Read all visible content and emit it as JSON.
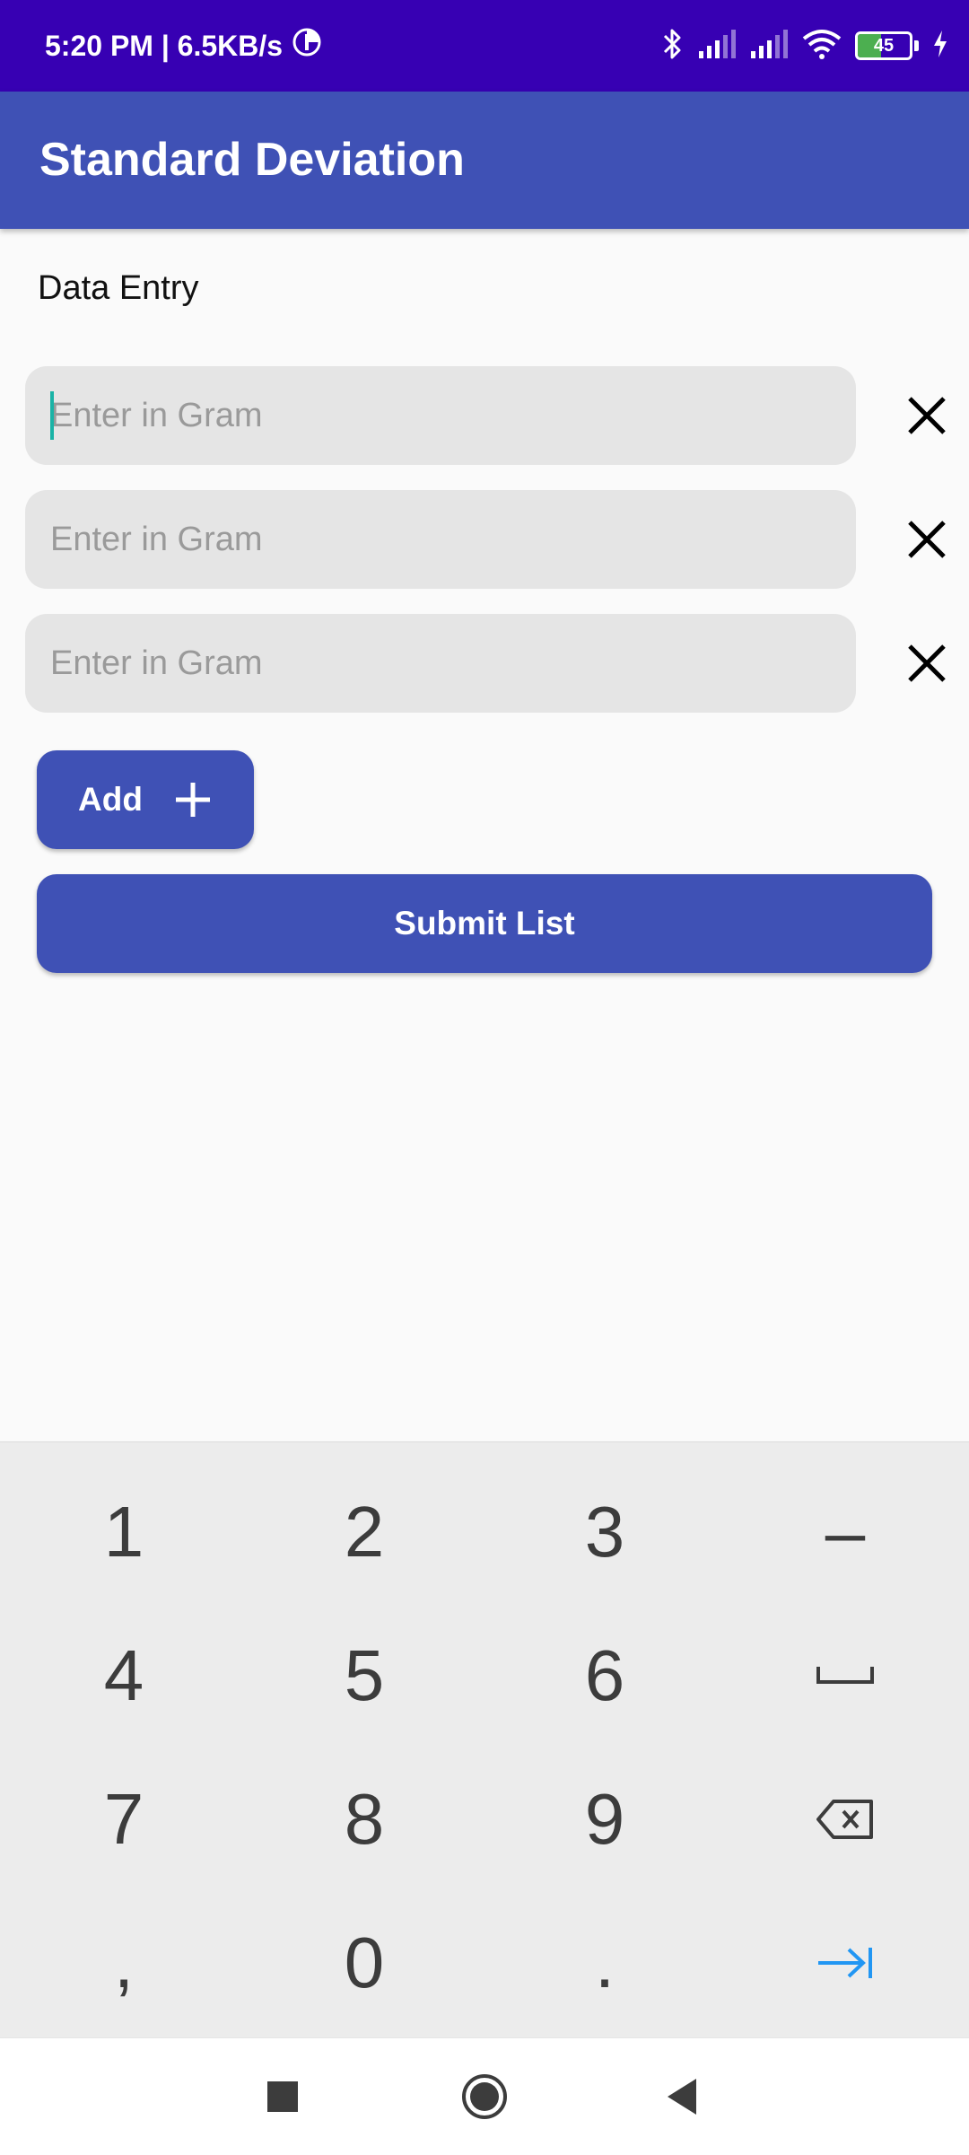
{
  "status_bar": {
    "time_speed": "5:20 PM | 6.5KB/s",
    "battery_level": "45",
    "battery_fraction": 0.45,
    "icons": [
      "data-saver-icon",
      "bluetooth-icon",
      "signal-icon",
      "signal-icon",
      "wifi-icon",
      "battery-icon",
      "charging-icon"
    ]
  },
  "app_bar": {
    "title": "Standard Deviation"
  },
  "section": {
    "label": "Data Entry"
  },
  "entries": [
    {
      "value": "",
      "placeholder": "Enter in Gram"
    },
    {
      "value": "",
      "placeholder": "Enter in Gram"
    },
    {
      "value": "",
      "placeholder": "Enter in Gram"
    }
  ],
  "buttons": {
    "add_label": "Add",
    "submit_label": "Submit List"
  },
  "colors": {
    "status_bar": "#3700b3",
    "primary": "#3f51b5",
    "caret": "#1ab3a6",
    "keyboard_bg": "#ececec",
    "next_key": "#2196f3"
  },
  "keyboard": {
    "keys": [
      [
        "1",
        "2",
        "3",
        "–"
      ],
      [
        "4",
        "5",
        "6",
        "space-icon"
      ],
      [
        "7",
        "8",
        "9",
        "backspace-icon"
      ],
      [
        ",",
        "0",
        ".",
        "next-field-icon"
      ]
    ]
  },
  "nav_bar": {
    "buttons": [
      "recents-icon",
      "home-icon",
      "back-icon"
    ]
  }
}
